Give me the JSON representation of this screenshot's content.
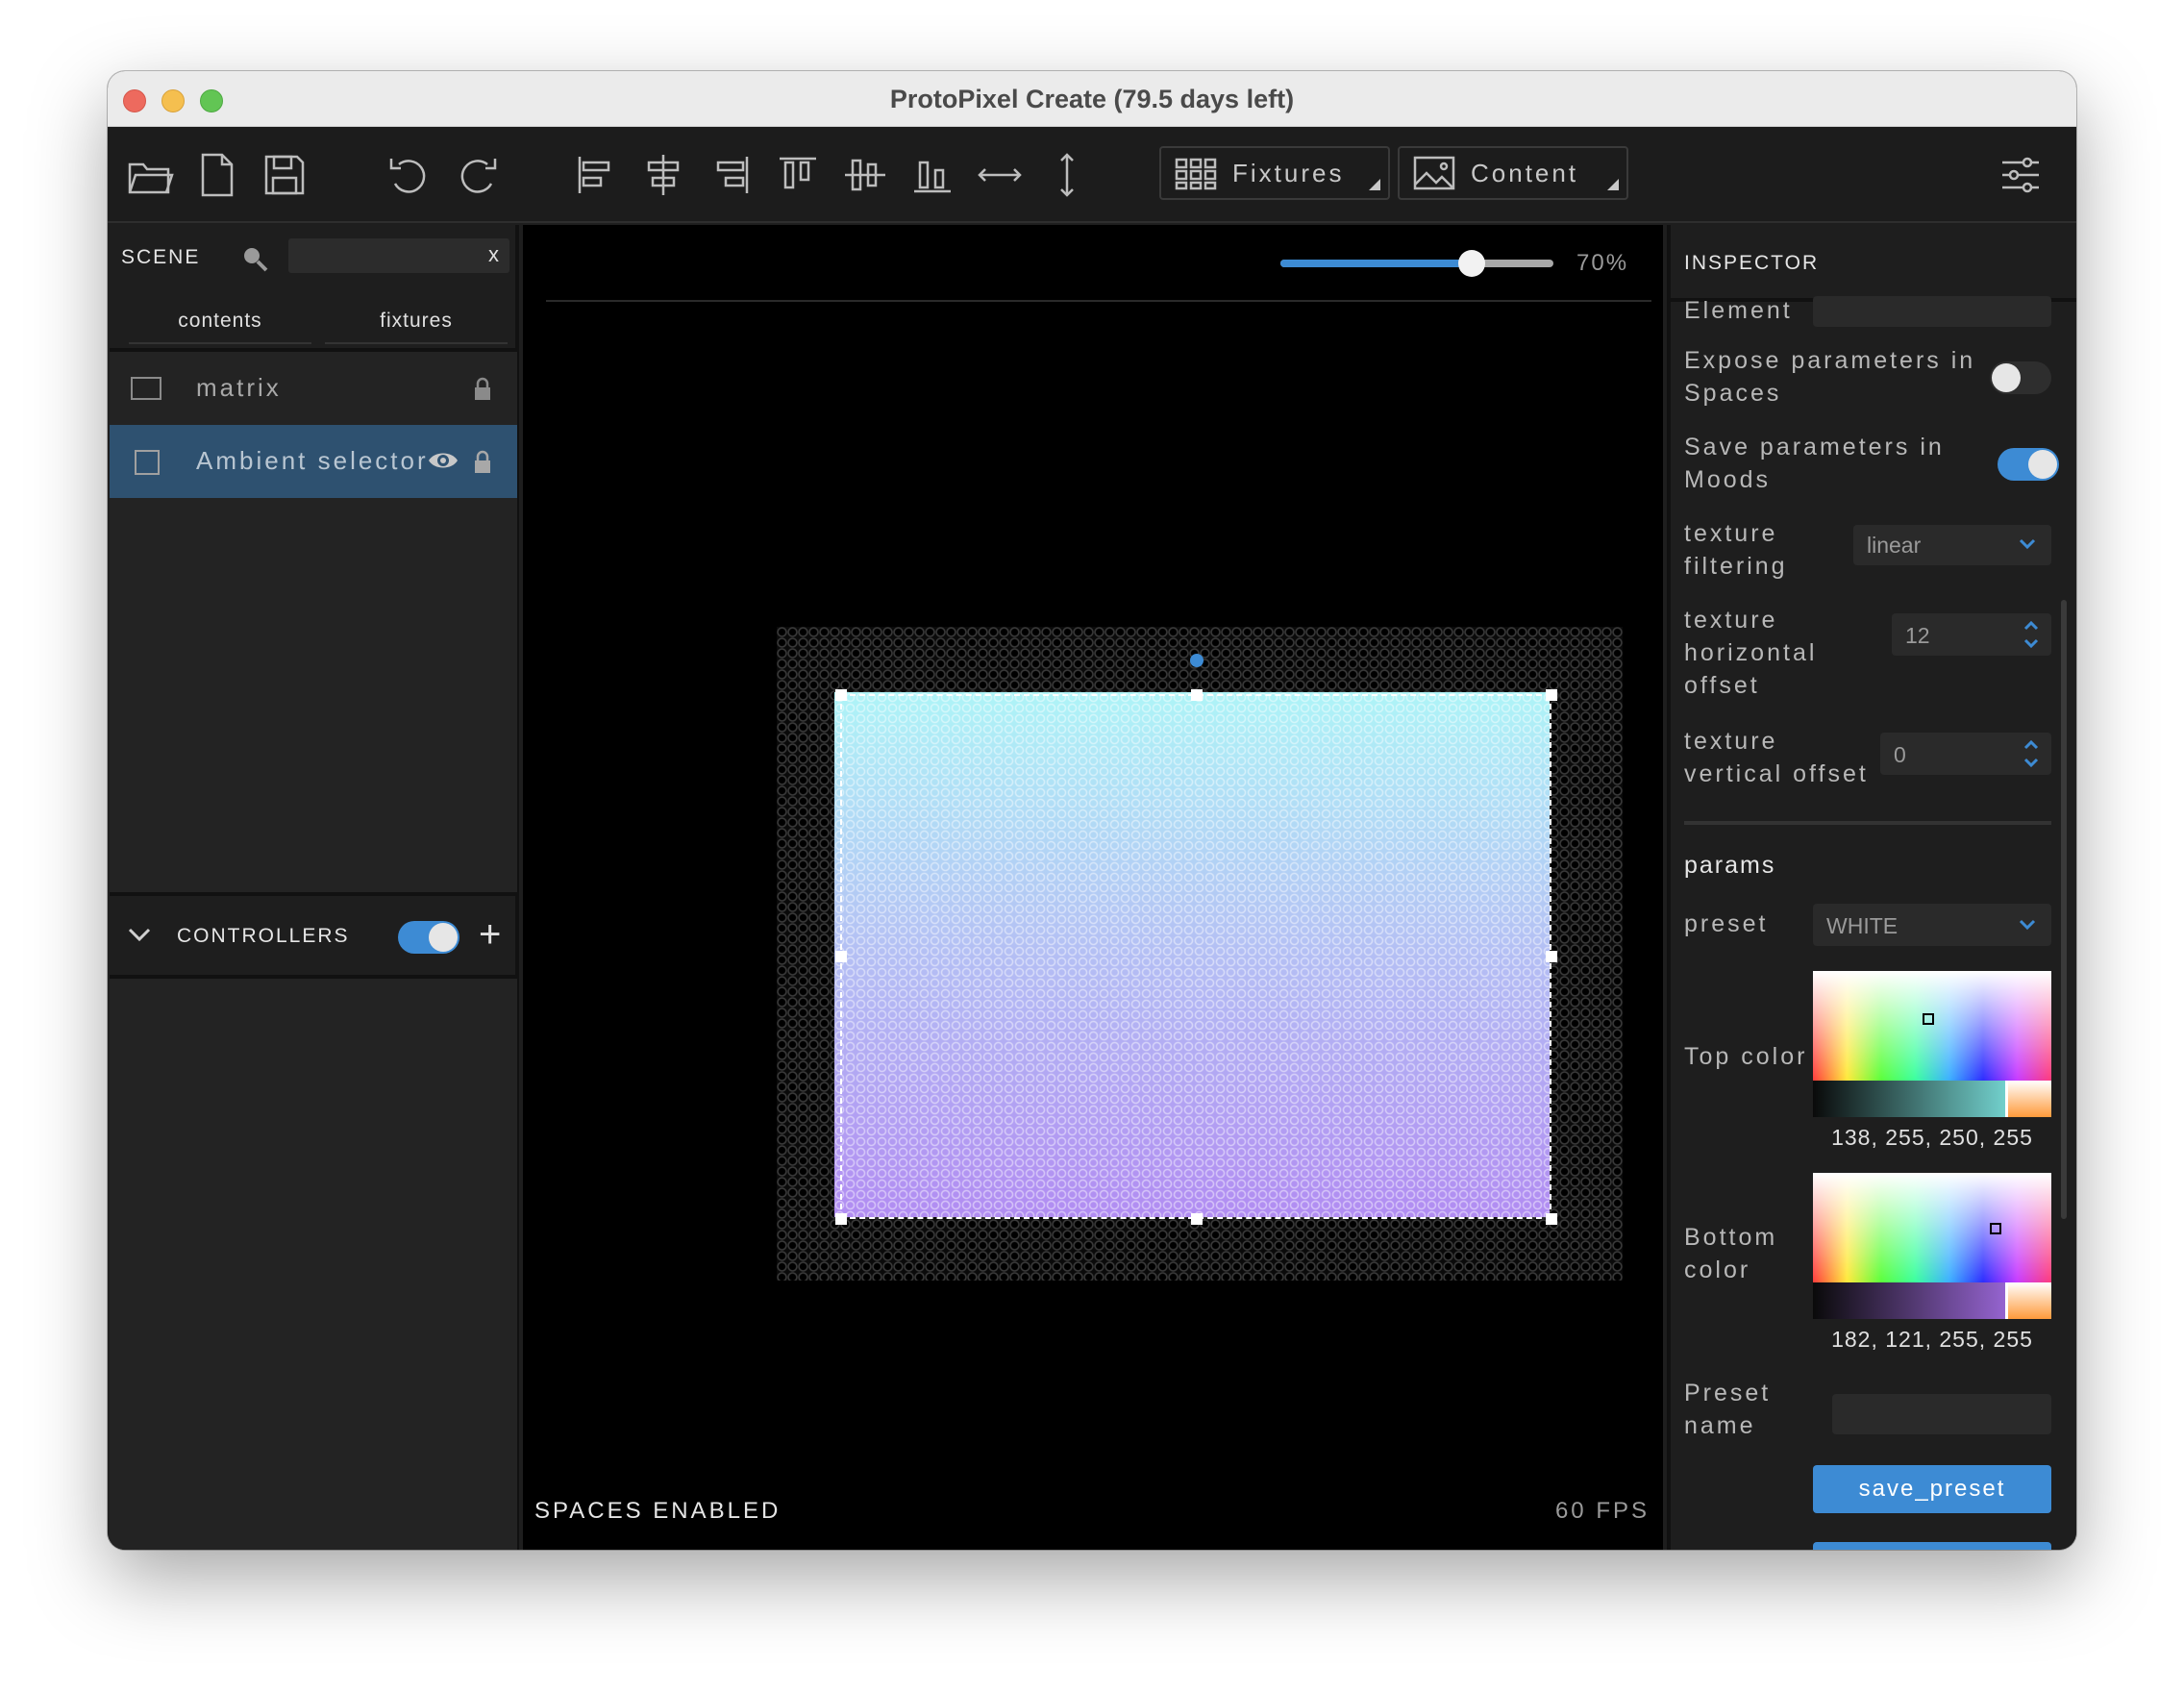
{
  "window": {
    "title": "ProtoPixel Create (79.5 days left)"
  },
  "toolbar": {
    "fixtures_label": "Fixtures",
    "content_label": "Content",
    "icons": [
      "open-folder-icon",
      "new-file-icon",
      "save-icon",
      "undo-icon",
      "redo-icon",
      "align-left-icon",
      "align-center-h-icon",
      "align-right-icon",
      "align-top-icon",
      "align-middle-v-icon",
      "align-bottom-icon",
      "distribute-h-icon",
      "distribute-v-icon",
      "settings-sliders-icon"
    ]
  },
  "scene": {
    "title": "SCENE",
    "search_clear": "x",
    "tabs": [
      "contents",
      "fixtures"
    ],
    "items": [
      {
        "label": "matrix",
        "selected": false
      },
      {
        "label": "Ambient selector",
        "selected": true
      }
    ]
  },
  "controllers": {
    "title": "CONTROLLERS",
    "add": "+",
    "enabled": true
  },
  "viewport": {
    "zoom_label": "70%",
    "zoom_value": 0.7,
    "status_left": "SPACES ENABLED",
    "status_right": "60 FPS",
    "gradient_top": "#8afffa",
    "gradient_bottom": "#b679ff"
  },
  "inspector": {
    "title": "INSPECTOR",
    "element_label": "Element",
    "expose_label_1": "Expose parameters in",
    "expose_label_2": "Spaces",
    "expose_on": false,
    "save_label_1": "Save parameters in",
    "save_label_2": "Moods",
    "save_on": true,
    "filtering_label_1": "texture",
    "filtering_label_2": "filtering",
    "filtering_value": "linear",
    "hoffset_label_1": "texture",
    "hoffset_label_2": "horizontal",
    "hoffset_label_3": "offset",
    "hoffset_value": "12",
    "voffset_label_1": "texture",
    "voffset_label_2": "vertical offset",
    "voffset_value": "0",
    "params_title": "params",
    "preset_label": "preset",
    "preset_value": "WHITE",
    "top_color_label": "Top color",
    "top_color_value": "138, 255, 250, 255",
    "top_color_hex": "#8afffa",
    "bottom_color_label_1": "Bottom",
    "bottom_color_label_2": "color",
    "bottom_color_value": "182, 121, 255, 255",
    "bottom_color_hex": "#b679ff",
    "preset_name_label_1": "Preset",
    "preset_name_label_2": "name",
    "save_preset_label": "save_preset",
    "accent": "#3d8bd4"
  }
}
